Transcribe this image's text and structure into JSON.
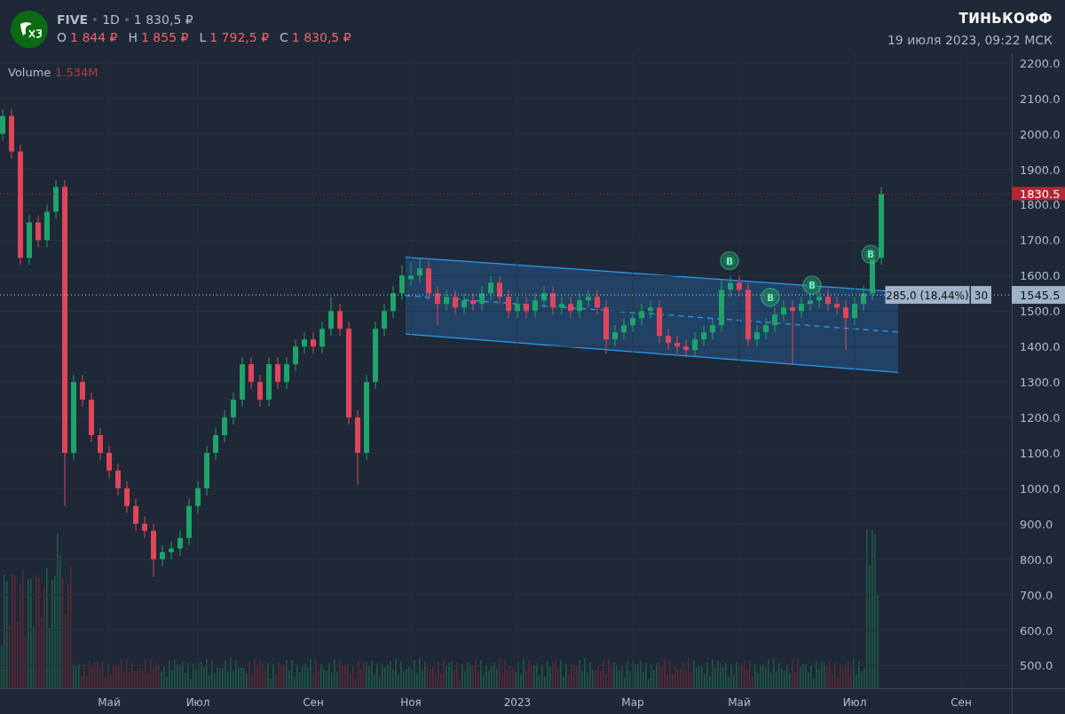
{
  "header": {
    "ticker": "FIVE",
    "interval": "1D",
    "price": "1 830,5 ₽",
    "ohlc": [
      {
        "key": "O",
        "value": "1 844 ₽"
      },
      {
        "key": "H",
        "value": "1 855 ₽"
      },
      {
        "key": "L",
        "value": "1 792,5 ₽"
      },
      {
        "key": "C",
        "value": "1 830,5 ₽"
      }
    ],
    "brand": "ТИНЬКОФФ",
    "datetime": "19 июля 2023, 09:22 МСК"
  },
  "volume": {
    "label": "Volume",
    "value": "1.534M"
  },
  "chart_data": {
    "type": "candlestick",
    "grid": true,
    "ylim": [
      436,
      2227
    ],
    "categories": [
      null,
      null,
      null,
      null,
      null,
      null,
      null,
      null,
      null,
      null,
      null,
      null,
      "Май",
      null,
      null,
      null,
      null,
      null,
      null,
      null,
      null,
      null,
      "Июл",
      null,
      null,
      null,
      null,
      null,
      null,
      null,
      null,
      null,
      null,
      null,
      null,
      "Сен",
      null,
      null,
      null,
      null,
      null,
      null,
      null,
      null,
      null,
      null,
      "Ноя",
      null,
      null,
      null,
      null,
      null,
      null,
      null,
      null,
      null,
      null,
      null,
      "2023",
      null,
      null,
      null,
      null,
      null,
      null,
      null,
      null,
      null,
      null,
      null,
      null,
      "Мар",
      null,
      null,
      null,
      null,
      null,
      null,
      null,
      null,
      null,
      null,
      null,
      "Май",
      null,
      null,
      null,
      null,
      null,
      null,
      null,
      null,
      null,
      null,
      null,
      null,
      "Июл",
      null,
      null,
      null,
      null,
      null,
      null,
      null,
      null,
      null,
      null,
      null,
      "Сен",
      null,
      null,
      null,
      null,
      null
    ],
    "ohlc": [
      [
        2000,
        2070,
        1980,
        2050
      ],
      [
        2050,
        2070,
        1930,
        1950
      ],
      [
        1950,
        1970,
        1630,
        1650
      ],
      [
        1650,
        1770,
        1630,
        1750
      ],
      [
        1750,
        1770,
        1680,
        1700
      ],
      [
        1700,
        1800,
        1680,
        1780
      ],
      [
        1780,
        1870,
        1760,
        1850
      ],
      [
        1850,
        1870,
        950,
        1100
      ],
      [
        1100,
        1320,
        1080,
        1300
      ],
      [
        1300,
        1320,
        1230,
        1250
      ],
      [
        1250,
        1270,
        1130,
        1150
      ],
      [
        1150,
        1170,
        1080,
        1100
      ],
      [
        1100,
        1120,
        1030,
        1050
      ],
      [
        1050,
        1070,
        980,
        1000
      ],
      [
        1000,
        1020,
        930,
        950
      ],
      [
        950,
        970,
        880,
        900
      ],
      [
        900,
        920,
        860,
        880
      ],
      [
        880,
        900,
        750,
        800
      ],
      [
        800,
        840,
        780,
        820
      ],
      [
        820,
        850,
        800,
        830
      ],
      [
        830,
        880,
        810,
        860
      ],
      [
        860,
        970,
        840,
        950
      ],
      [
        950,
        1020,
        930,
        1000
      ],
      [
        1000,
        1120,
        980,
        1100
      ],
      [
        1100,
        1170,
        1080,
        1150
      ],
      [
        1150,
        1220,
        1130,
        1200
      ],
      [
        1200,
        1270,
        1180,
        1250
      ],
      [
        1250,
        1370,
        1230,
        1350
      ],
      [
        1350,
        1370,
        1280,
        1300
      ],
      [
        1300,
        1320,
        1230,
        1250
      ],
      [
        1250,
        1370,
        1230,
        1350
      ],
      [
        1350,
        1370,
        1280,
        1300
      ],
      [
        1300,
        1370,
        1280,
        1350
      ],
      [
        1350,
        1420,
        1330,
        1400
      ],
      [
        1400,
        1440,
        1380,
        1420
      ],
      [
        1420,
        1440,
        1380,
        1400
      ],
      [
        1400,
        1470,
        1380,
        1450
      ],
      [
        1450,
        1540,
        1430,
        1500
      ],
      [
        1500,
        1520,
        1430,
        1450
      ],
      [
        1450,
        1470,
        1180,
        1200
      ],
      [
        1200,
        1220,
        1010,
        1100
      ],
      [
        1100,
        1320,
        1080,
        1300
      ],
      [
        1300,
        1470,
        1280,
        1450
      ],
      [
        1450,
        1520,
        1430,
        1500
      ],
      [
        1500,
        1570,
        1480,
        1550
      ],
      [
        1550,
        1630,
        1530,
        1600
      ],
      [
        1590,
        1640,
        1570,
        1600
      ],
      [
        1600,
        1650,
        1580,
        1620
      ],
      [
        1620,
        1640,
        1530,
        1550
      ],
      [
        1550,
        1570,
        1460,
        1520
      ],
      [
        1520,
        1560,
        1500,
        1540
      ],
      [
        1540,
        1560,
        1490,
        1510
      ],
      [
        1510,
        1550,
        1490,
        1530
      ],
      [
        1530,
        1550,
        1500,
        1520
      ],
      [
        1520,
        1570,
        1500,
        1550
      ],
      [
        1550,
        1600,
        1530,
        1580
      ],
      [
        1580,
        1600,
        1520,
        1540
      ],
      [
        1540,
        1560,
        1480,
        1500
      ],
      [
        1500,
        1540,
        1480,
        1520
      ],
      [
        1520,
        1540,
        1480,
        1500
      ],
      [
        1500,
        1550,
        1480,
        1530
      ],
      [
        1530,
        1570,
        1510,
        1550
      ],
      [
        1550,
        1570,
        1490,
        1510
      ],
      [
        1510,
        1540,
        1490,
        1520
      ],
      [
        1520,
        1540,
        1480,
        1500
      ],
      [
        1500,
        1550,
        1480,
        1530
      ],
      [
        1530,
        1560,
        1510,
        1540
      ],
      [
        1540,
        1560,
        1490,
        1510
      ],
      [
        1510,
        1530,
        1380,
        1420
      ],
      [
        1420,
        1460,
        1400,
        1440
      ],
      [
        1440,
        1480,
        1420,
        1460
      ],
      [
        1460,
        1500,
        1440,
        1480
      ],
      [
        1480,
        1520,
        1460,
        1500
      ],
      [
        1500,
        1530,
        1480,
        1510
      ],
      [
        1510,
        1530,
        1410,
        1430
      ],
      [
        1430,
        1450,
        1390,
        1410
      ],
      [
        1410,
        1430,
        1380,
        1400
      ],
      [
        1400,
        1420,
        1370,
        1390
      ],
      [
        1390,
        1440,
        1370,
        1420
      ],
      [
        1420,
        1460,
        1400,
        1440
      ],
      [
        1440,
        1480,
        1420,
        1460
      ],
      [
        1460,
        1590,
        1440,
        1560
      ],
      [
        1560,
        1600,
        1540,
        1580
      ],
      [
        1580,
        1600,
        1540,
        1560
      ],
      [
        1560,
        1580,
        1400,
        1420
      ],
      [
        1420,
        1460,
        1400,
        1440
      ],
      [
        1440,
        1480,
        1420,
        1460
      ],
      [
        1460,
        1510,
        1440,
        1490
      ],
      [
        1490,
        1530,
        1470,
        1510
      ],
      [
        1510,
        1530,
        1350,
        1500
      ],
      [
        1500,
        1540,
        1480,
        1520
      ],
      [
        1520,
        1550,
        1500,
        1530
      ],
      [
        1530,
        1570,
        1510,
        1540
      ],
      [
        1540,
        1560,
        1500,
        1520
      ],
      [
        1520,
        1540,
        1490,
        1510
      ],
      [
        1510,
        1530,
        1390,
        1480
      ],
      [
        1480,
        1540,
        1460,
        1520
      ],
      [
        1520,
        1570,
        1500,
        1550
      ],
      [
        1550,
        1670,
        1530,
        1650
      ],
      [
        1650,
        1850,
        1630,
        1830
      ],
      null,
      null,
      null,
      null,
      null,
      null,
      null,
      null,
      null,
      null,
      null,
      null,
      null,
      null
    ],
    "yticks": [
      {
        "value": 2200,
        "label": "2200.0"
      },
      {
        "value": 2100,
        "label": "2100.0"
      },
      {
        "value": 2000,
        "label": "2000.0"
      },
      {
        "value": 1900,
        "label": "1900.0"
      },
      {
        "value": 1800,
        "label": "1800.0"
      },
      {
        "value": 1700,
        "label": "1700.0"
      },
      {
        "value": 1600,
        "label": "1600.0"
      },
      {
        "value": 1500,
        "label": "1500.0"
      },
      {
        "value": 1400,
        "label": "1400.0"
      },
      {
        "value": 1300,
        "label": "1300.0"
      },
      {
        "value": 1200,
        "label": "1200.0"
      },
      {
        "value": 1100,
        "label": "1100.0"
      },
      {
        "value": 1000,
        "label": "1000.0"
      },
      {
        "value": 900,
        "label": "900.0"
      },
      {
        "value": 800,
        "label": "800.0"
      },
      {
        "value": 700,
        "label": "700.0"
      },
      {
        "value": 600,
        "label": "600.0"
      },
      {
        "value": 500,
        "label": "500.0"
      }
    ]
  },
  "price_labels": [
    {
      "kind": "last",
      "text": "1830.5",
      "color": "#b22833"
    },
    {
      "kind": "crosshair",
      "text": "1545.5"
    }
  ],
  "measurement": {
    "change": "285,0 (18,44%)",
    "bars": "30"
  },
  "signals": [
    {
      "label": "B"
    },
    {
      "label": "B"
    },
    {
      "label": "B"
    },
    {
      "label": "B"
    }
  ]
}
